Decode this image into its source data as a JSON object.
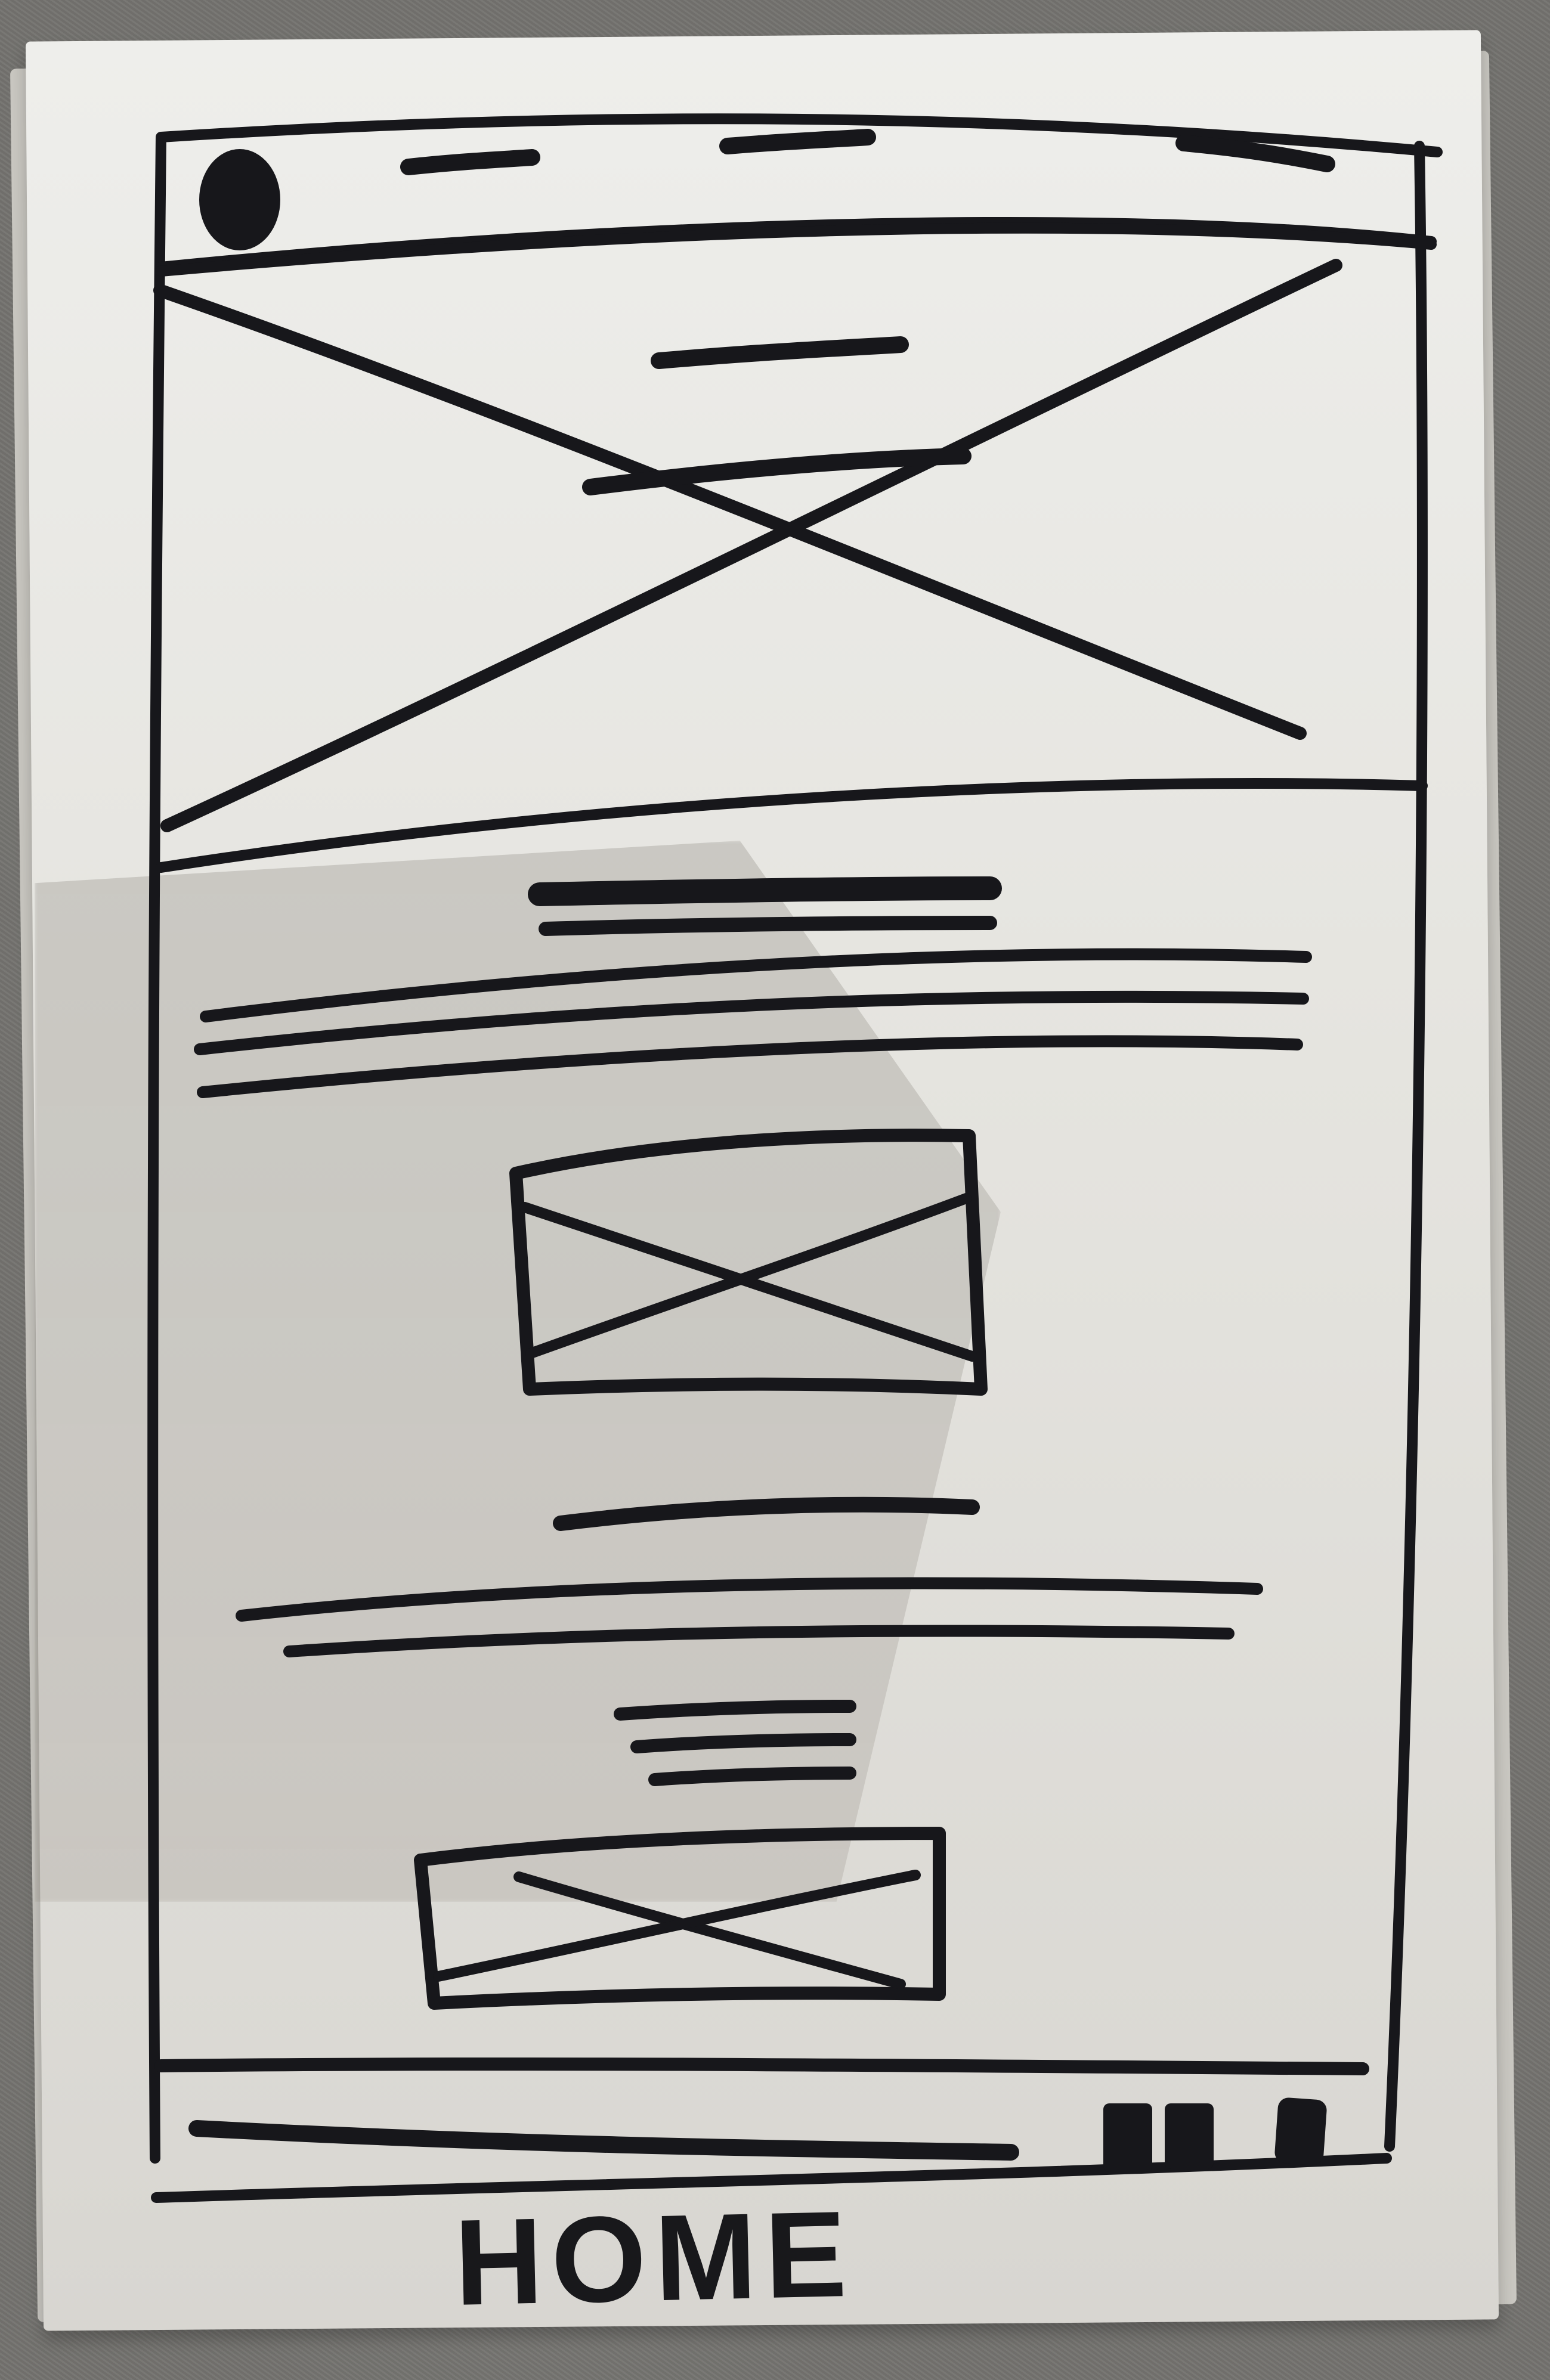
{
  "page_label": "HOME",
  "wireframe": {
    "header": {
      "logo": "avatar-icon",
      "nav_items": 3
    },
    "hero_image": "image-placeholder",
    "sections": [
      {
        "type": "text-block"
      },
      {
        "type": "image-placeholder"
      },
      {
        "type": "text-block"
      },
      {
        "type": "image-placeholder"
      }
    ],
    "footer": {
      "social_icons": 3
    }
  }
}
